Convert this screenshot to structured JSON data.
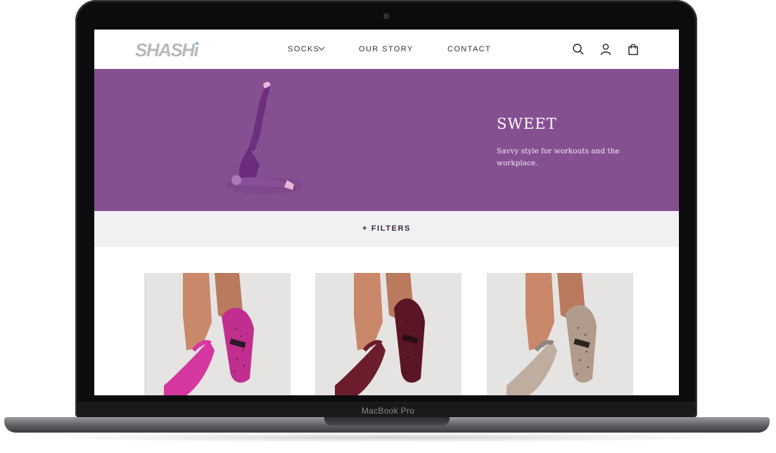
{
  "device": {
    "brand_label": "MacBook Pro"
  },
  "header": {
    "logo_text": "SHASHi",
    "nav": [
      {
        "label": "SOCKS",
        "has_dropdown": true
      },
      {
        "label": "OUR STORY"
      },
      {
        "label": "CONTACT"
      }
    ],
    "icons": [
      "search-icon",
      "account-icon",
      "cart-icon"
    ]
  },
  "hero": {
    "title": "SWEET",
    "subtitle": "Savvy style for workouts and the workplace.",
    "background_color": "#864f92"
  },
  "filters": {
    "label": "+ FILTERS"
  },
  "products": [
    {
      "sock_color": "#d6379f",
      "sole_color": "#c02f8f"
    },
    {
      "sock_color": "#6b1d2c",
      "sole_color": "#5a1624"
    },
    {
      "sock_color": "#bfada0",
      "sole_color": "#b09b8d"
    }
  ]
}
